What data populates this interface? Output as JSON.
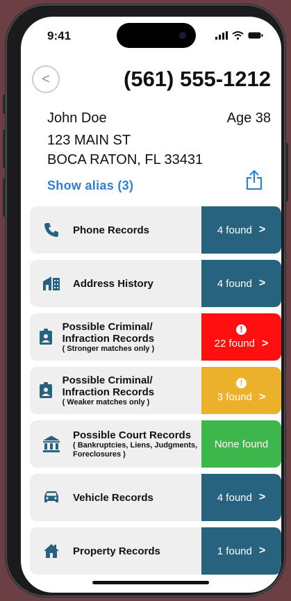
{
  "status": {
    "time": "9:41"
  },
  "header": {
    "back_label": "<",
    "phone": "(561) 555-1212"
  },
  "person": {
    "name": "John Doe",
    "age": "Age 38",
    "address_line1": "123 MAIN ST",
    "address_line2": "BOCA RATON, FL 33431",
    "alias_link": "Show alias (3)"
  },
  "colors": {
    "blue": "#27637f",
    "red": "#ff0f0f",
    "amber": "#ebb12b",
    "green": "#3db74c",
    "link": "#2d7fd6"
  },
  "records": [
    {
      "title": "Phone Records",
      "subtitle": "",
      "result": "4 found",
      "icon": "phone-icon",
      "status_color": "#27637f"
    },
    {
      "title": "Address History",
      "subtitle": "",
      "result": "4 found",
      "icon": "building-icon",
      "status_color": "#27637f"
    },
    {
      "title": "Possible Criminal/ Infraction Records",
      "subtitle": "( Stronger matches only )",
      "result": "22 found",
      "alert": "!",
      "icon": "badge-icon",
      "status_color": "#ff0f0f"
    },
    {
      "title": "Possible Criminal/ Infraction Records",
      "subtitle": "( Weaker matches only )",
      "result": "3 found",
      "alert": "!",
      "icon": "badge-icon",
      "status_color": "#ebb12b"
    },
    {
      "title": "Possible Court Records",
      "subtitle": "( Bankruptcies, Liens, Judgments, Foreclosures )",
      "result": "None found",
      "icon": "courthouse-icon",
      "status_color": "#3db74c"
    },
    {
      "title": "Vehicle Records",
      "subtitle": "",
      "result": "4 found",
      "icon": "car-icon",
      "status_color": "#27637f"
    },
    {
      "title": "Property Records",
      "subtitle": "",
      "result": "1 found",
      "icon": "house-icon",
      "status_color": "#27637f"
    }
  ],
  "chevron": ">"
}
